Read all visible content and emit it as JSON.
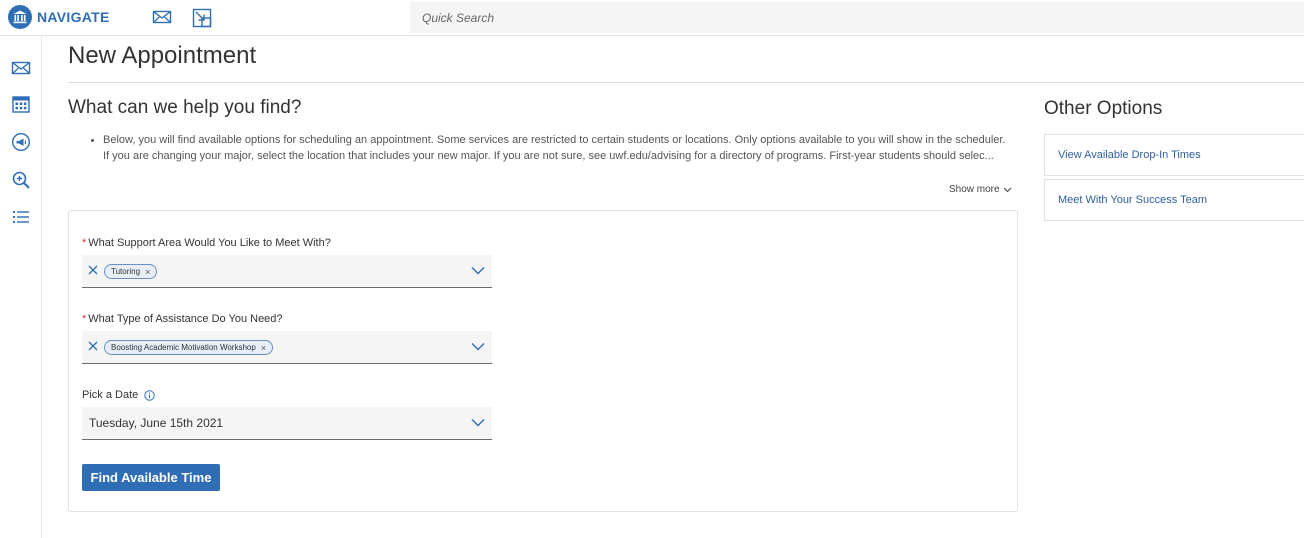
{
  "topbar": {
    "brand": "NAVIGATE",
    "search_placeholder": "Quick Search"
  },
  "page": {
    "title": "New Appointment"
  },
  "help": {
    "heading": "What can we help you find?",
    "bullets": [
      "Below, you will find available options for scheduling an appointment. Some services are restricted to certain students or locations. Only options available to you will show in the scheduler.",
      "If you are changing your major, select the location that includes your new major. If you are not sure, see uwf.edu/advising for a directory of programs. First-year students should selec..."
    ],
    "show_more": "Show more"
  },
  "form": {
    "support_area": {
      "label": "What Support Area Would You Like to Meet With?",
      "required_mark": "*",
      "chip": "Tutoring",
      "chip_remove": "×"
    },
    "assistance_type": {
      "label": "What Type of Assistance Do You Need?",
      "required_mark": "*",
      "chip": "Boosting Academic Motivation Workshop",
      "chip_remove": "×"
    },
    "date": {
      "label": "Pick a Date",
      "value": "Tuesday, June 15th 2021"
    },
    "submit_label": "Find Available Time"
  },
  "other_options": {
    "heading": "Other Options",
    "items": [
      "View Available Drop-In Times",
      "Meet With Your Success Team"
    ]
  },
  "colors": {
    "brand": "#2f6db5",
    "link": "#2f5f9e",
    "required": "#c0392b",
    "chip_bg": "#e7eef8"
  },
  "icons": {
    "topbar": [
      "university-logo-icon",
      "mail-icon",
      "split-view-icon"
    ],
    "sidebar": [
      "mail-icon",
      "calendar-icon",
      "megaphone-icon",
      "search-zoom-icon",
      "list-icon"
    ]
  }
}
